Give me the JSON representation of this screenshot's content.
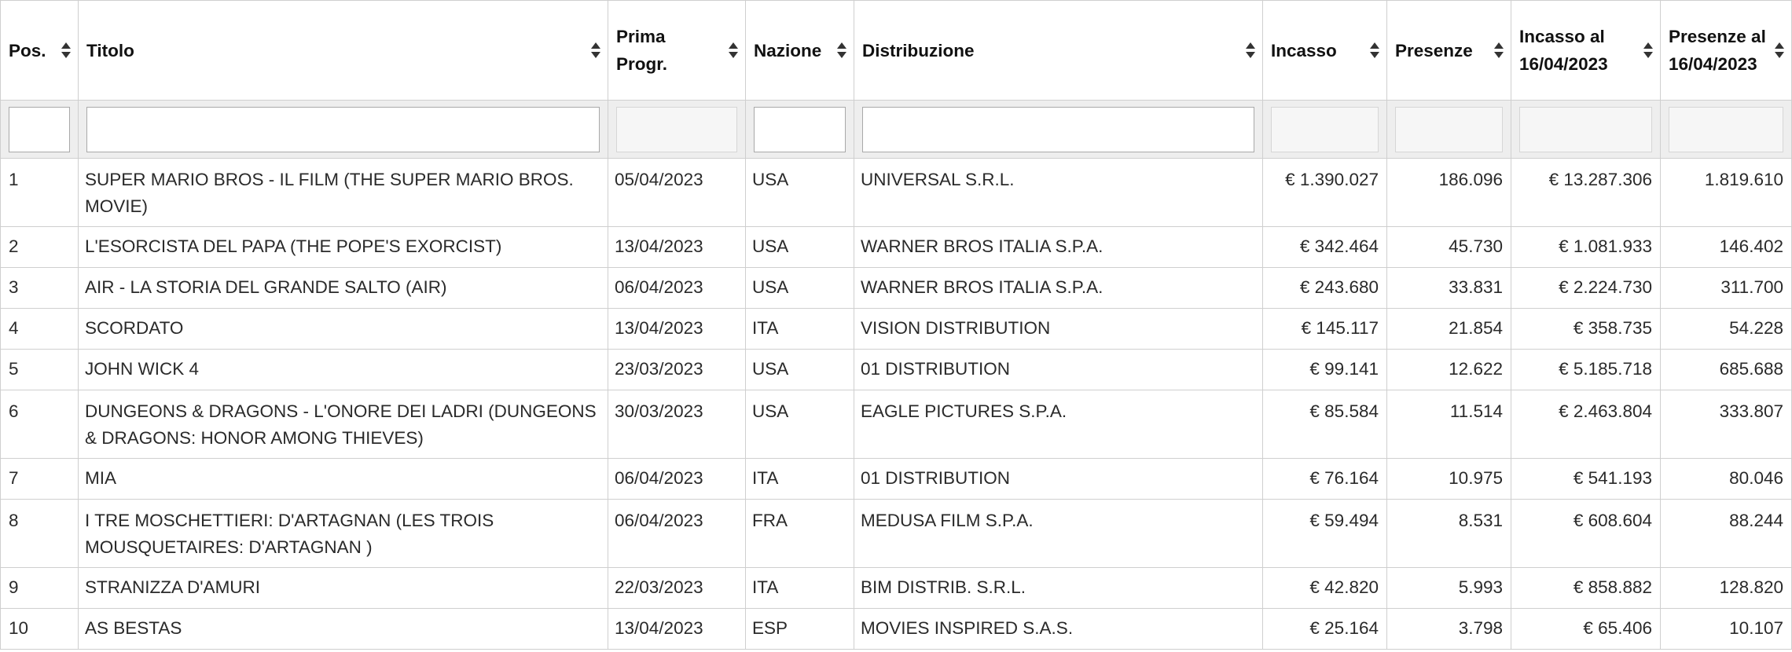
{
  "table": {
    "columns": [
      {
        "key": "pos",
        "label": "Pos."
      },
      {
        "key": "titolo",
        "label": "Titolo"
      },
      {
        "key": "prima",
        "label": "Prima Progr."
      },
      {
        "key": "nazione",
        "label": "Nazione"
      },
      {
        "key": "distribuzione",
        "label": "Distribuzione"
      },
      {
        "key": "incasso",
        "label": "Incasso"
      },
      {
        "key": "presenze",
        "label": "Presenze"
      },
      {
        "key": "incasso_al",
        "label": "Incasso al 16/04/2023"
      },
      {
        "key": "presenze_al",
        "label": "Presenze al 16/04/2023"
      }
    ],
    "filters": {
      "pos": "",
      "titolo": "",
      "prima": "",
      "nazione": "",
      "distribuzione": "",
      "incasso": "",
      "presenze": "",
      "incasso_al": "",
      "presenze_al": ""
    },
    "rows": [
      {
        "pos": "1",
        "titolo": "SUPER MARIO BROS - IL FILM (THE SUPER MARIO BROS. MOVIE)",
        "prima": "05/04/2023",
        "nazione": "USA",
        "distribuzione": "UNIVERSAL S.R.L.",
        "incasso": "€ 1.390.027",
        "presenze": "186.096",
        "incasso_al": "€ 13.287.306",
        "presenze_al": "1.819.610"
      },
      {
        "pos": "2",
        "titolo": "L'ESORCISTA DEL PAPA (THE POPE'S EXORCIST)",
        "prima": "13/04/2023",
        "nazione": "USA",
        "distribuzione": "WARNER BROS ITALIA S.P.A.",
        "incasso": "€ 342.464",
        "presenze": "45.730",
        "incasso_al": "€ 1.081.933",
        "presenze_al": "146.402"
      },
      {
        "pos": "3",
        "titolo": "AIR - LA STORIA DEL GRANDE SALTO (AIR)",
        "prima": "06/04/2023",
        "nazione": "USA",
        "distribuzione": "WARNER BROS ITALIA S.P.A.",
        "incasso": "€ 243.680",
        "presenze": "33.831",
        "incasso_al": "€ 2.224.730",
        "presenze_al": "311.700"
      },
      {
        "pos": "4",
        "titolo": "SCORDATO",
        "prima": "13/04/2023",
        "nazione": "ITA",
        "distribuzione": "VISION DISTRIBUTION",
        "incasso": "€ 145.117",
        "presenze": "21.854",
        "incasso_al": "€ 358.735",
        "presenze_al": "54.228"
      },
      {
        "pos": "5",
        "titolo": "JOHN WICK 4",
        "prima": "23/03/2023",
        "nazione": "USA",
        "distribuzione": "01 DISTRIBUTION",
        "incasso": "€ 99.141",
        "presenze": "12.622",
        "incasso_al": "€ 5.185.718",
        "presenze_al": "685.688"
      },
      {
        "pos": "6",
        "titolo": "DUNGEONS & DRAGONS - L'ONORE DEI LADRI (DUNGEONS & DRAGONS: HONOR AMONG THIEVES)",
        "prima": "30/03/2023",
        "nazione": "USA",
        "distribuzione": "EAGLE PICTURES S.P.A.",
        "incasso": "€ 85.584",
        "presenze": "11.514",
        "incasso_al": "€ 2.463.804",
        "presenze_al": "333.807"
      },
      {
        "pos": "7",
        "titolo": "MIA",
        "prima": "06/04/2023",
        "nazione": "ITA",
        "distribuzione": "01 DISTRIBUTION",
        "incasso": "€ 76.164",
        "presenze": "10.975",
        "incasso_al": "€ 541.193",
        "presenze_al": "80.046"
      },
      {
        "pos": "8",
        "titolo": "I TRE MOSCHETTIERI: D'ARTAGNAN (LES TROIS MOUSQUETAIRES: D'ARTAGNAN )",
        "prima": "06/04/2023",
        "nazione": "FRA",
        "distribuzione": "MEDUSA FILM S.P.A.",
        "incasso": "€ 59.494",
        "presenze": "8.531",
        "incasso_al": "€ 608.604",
        "presenze_al": "88.244"
      },
      {
        "pos": "9",
        "titolo": "STRANIZZA D'AMURI",
        "prima": "22/03/2023",
        "nazione": "ITA",
        "distribuzione": "BIM DISTRIB. S.R.L.",
        "incasso": "€ 42.820",
        "presenze": "5.993",
        "incasso_al": "€ 858.882",
        "presenze_al": "128.820"
      },
      {
        "pos": "10",
        "titolo": "AS BESTAS",
        "prima": "13/04/2023",
        "nazione": "ESP",
        "distribuzione": "MOVIES INSPIRED S.A.S.",
        "incasso": "€ 25.164",
        "presenze": "3.798",
        "incasso_al": "€ 65.406",
        "presenze_al": "10.107"
      }
    ]
  }
}
